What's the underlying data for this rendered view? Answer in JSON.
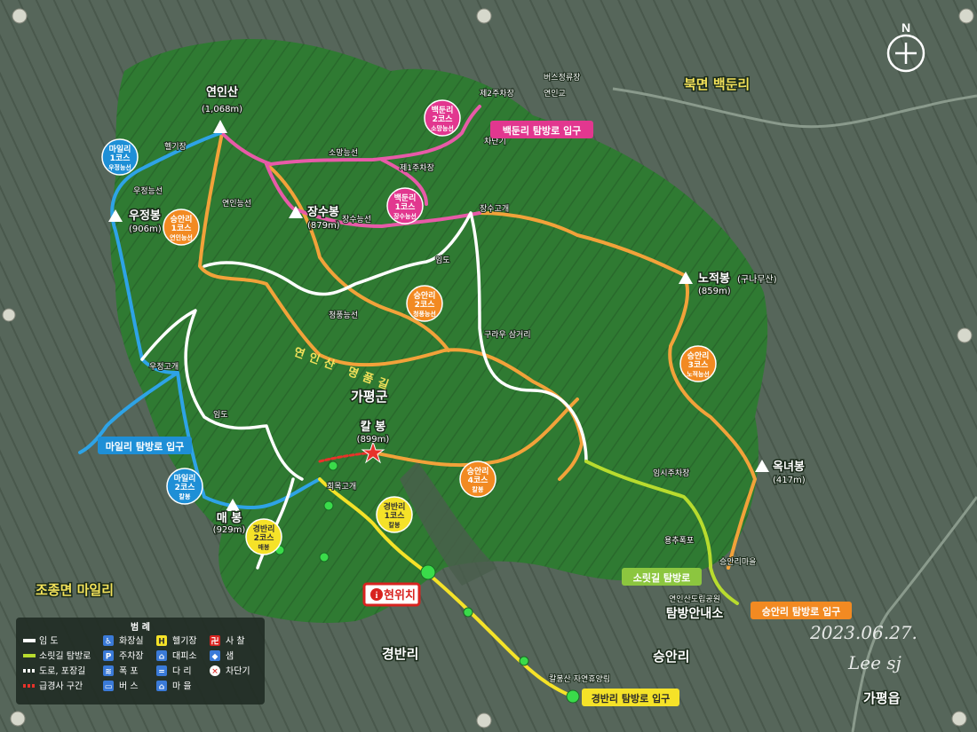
{
  "colors": {
    "mountain": "#2f7a32",
    "mountain_dark": "#245f27",
    "valley": "#5a6a5c",
    "course_orange": "#f2a23a",
    "course_pink": "#e85aa8",
    "course_blue": "#2ea3e6",
    "road_white": "#ffffff",
    "sorit": "#b8dc2e",
    "label_pink": "#e2378f",
    "label_blue": "#1e8fd6",
    "label_green": "#8cc63f",
    "label_orange": "#f28a22",
    "label_yellow": "#f5e228",
    "here_red": "#d8231f"
  },
  "regions": {
    "bukmyeon": "북면 백둔리",
    "gapyeonggun": "가평군",
    "jojongmyeon": "조종면 마일리",
    "gyeongbanri": "경반리",
    "seunganri": "승안리",
    "gapyeongeup": "가평읍"
  },
  "peaks": {
    "yeonin": {
      "name": "연인산",
      "height": "(1,068m)"
    },
    "ujeong": {
      "name": "우정봉",
      "height": "(906m)"
    },
    "jangsu": {
      "name": "장수봉",
      "height": "(879m)"
    },
    "nojeok": {
      "name": "노적봉",
      "height": "(859m)",
      "alt": "(구나무산)"
    },
    "kal": {
      "name": "칼 봉",
      "height": "(899m)"
    },
    "okneo": {
      "name": "옥녀봉",
      "height": "(417m)"
    },
    "mae": {
      "name": "매 봉",
      "height": "(929m)"
    }
  },
  "places": {
    "jangsu_pass": "장수고개",
    "ujeong_pass": "우정고개",
    "hoemok_pass": "회목고개",
    "soman_ridge": "소망능선",
    "yeonin_ridge": "연인능선",
    "ujeong_ridge": "우정능선",
    "jangsu_ridge": "장수능선",
    "cheongpung_ridge": "청풍능선",
    "seunganri_village": "승안리마을",
    "helipad": "헬기장",
    "imdo": "임도",
    "bus_terminal": "버스정류장",
    "lot2": "제2주차장",
    "lot1": "제1주차장",
    "yeonin_school": "연인교",
    "barrier": "차단기",
    "kuraru": "구라우 삼거리",
    "temp_lot": "임시주차장",
    "waterfall": "용추폭포",
    "yeonin_office_top": "연인산도립공원",
    "yeonin_office": "탐방안내소",
    "gyeongbanri_lodge": "칼봉산 자연휴양림"
  },
  "courses": {
    "baekdun2": {
      "line1": "백둔리",
      "line2": "2코스",
      "line3": "소망능선"
    },
    "baekdun1": {
      "line1": "백둔리",
      "line2": "1코스",
      "line3": "장수능선"
    },
    "mail1": {
      "line1": "마일리",
      "line2": "1코스",
      "line3": "우정능선"
    },
    "seungan1": {
      "line1": "승안리",
      "line2": "1코스",
      "line3": "연인능선"
    },
    "seungan2": {
      "line1": "승안리",
      "line2": "2코스",
      "line3": "청풍능선"
    },
    "seungan3": {
      "line1": "승안리",
      "line2": "3코스",
      "line3": "노적능선"
    },
    "seungan4": {
      "line1": "승안리",
      "line2": "4코스",
      "line3": "칼봉"
    },
    "mail2": {
      "line1": "마일리",
      "line2": "2코스",
      "line3": "칼봉"
    },
    "gyeongban1": {
      "line1": "경반리",
      "line2": "1코스",
      "line3": "칼봉"
    },
    "gyeongban2": {
      "line1": "경반리",
      "line2": "2코스",
      "line3": "매봉"
    }
  },
  "entrances": {
    "baekdun": "백둔리 탐방로 입구",
    "mail": "마일리 탐방로 입구",
    "seungan": "승안리 탐방로 입구",
    "gyeongban": "경반리 탐방로 입구",
    "sorit": "소릿길 탐방로",
    "here": "현위치"
  },
  "trail_text": "연인산 명품길",
  "compass": "N",
  "stamp": {
    "date": "2023.06.27.",
    "author": "Lee sj"
  },
  "legend": {
    "title": "범  례",
    "items": [
      {
        "icon": "imdo",
        "label": "임  도"
      },
      {
        "icon": "sorit",
        "label": "소릿길 탐방로"
      },
      {
        "icon": "road",
        "label": "도로, 포장길"
      },
      {
        "icon": "steep",
        "label": "급경사 구간"
      },
      {
        "icon": "toilet",
        "label": "화장실"
      },
      {
        "icon": "parking",
        "label": "주차장"
      },
      {
        "icon": "waterfall",
        "label": "폭  포"
      },
      {
        "icon": "bus",
        "label": "버  스"
      },
      {
        "icon": "heli",
        "label": "헬기장"
      },
      {
        "icon": "shelter",
        "label": "대피소"
      },
      {
        "icon": "bridge",
        "label": "다  리"
      },
      {
        "icon": "village",
        "label": "마  을"
      },
      {
        "icon": "temple",
        "label": "사  찰"
      },
      {
        "icon": "spring",
        "label": "샘"
      },
      {
        "icon": "gate",
        "label": "차단기"
      }
    ]
  }
}
